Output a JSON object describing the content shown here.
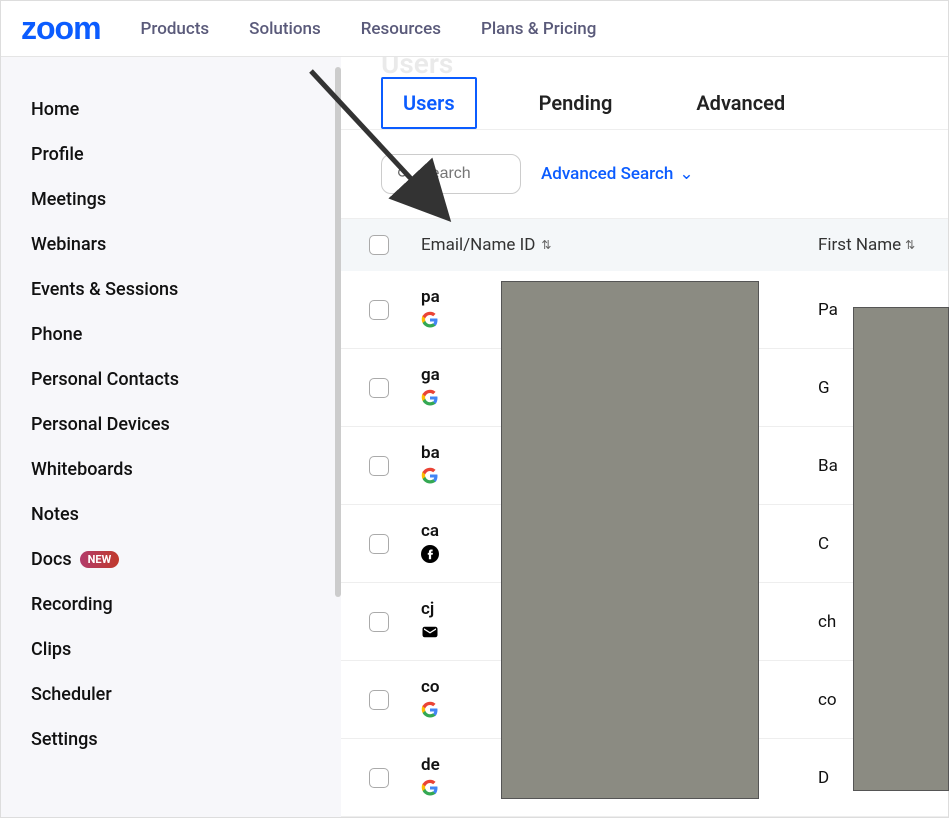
{
  "topnav": {
    "logo": "zoom",
    "items": [
      "Products",
      "Solutions",
      "Resources",
      "Plans & Pricing"
    ]
  },
  "sidebar": {
    "items": [
      {
        "label": "Home"
      },
      {
        "label": "Profile"
      },
      {
        "label": "Meetings"
      },
      {
        "label": "Webinars"
      },
      {
        "label": "Events & Sessions"
      },
      {
        "label": "Phone"
      },
      {
        "label": "Personal Contacts"
      },
      {
        "label": "Personal Devices"
      },
      {
        "label": "Whiteboards"
      },
      {
        "label": "Notes"
      },
      {
        "label": "Docs",
        "badge": "NEW"
      },
      {
        "label": "Recording"
      },
      {
        "label": "Clips"
      },
      {
        "label": "Scheduler"
      },
      {
        "label": "Settings"
      }
    ]
  },
  "main": {
    "faded_heading": "Users",
    "tabs": [
      {
        "label": "Users",
        "active": true
      },
      {
        "label": "Pending"
      },
      {
        "label": "Advanced"
      }
    ],
    "search_placeholder": "Search",
    "advanced_search": "Advanced Search",
    "columns": {
      "email": "Email/Name ID",
      "first_name": "First Name"
    },
    "rows": [
      {
        "email_prefix": "pa",
        "provider": "google",
        "fname_prefix": "Pa"
      },
      {
        "email_prefix": "ga",
        "provider": "google",
        "fname_prefix": "G"
      },
      {
        "email_prefix": "ba",
        "provider": "google",
        "fname_prefix": "Ba"
      },
      {
        "email_prefix": "ca",
        "provider": "facebook",
        "fname_prefix": "C"
      },
      {
        "email_prefix": "cj",
        "provider": "email",
        "fname_prefix": "ch"
      },
      {
        "email_prefix": "co",
        "provider": "google",
        "fname_prefix": "co"
      },
      {
        "email_prefix": "de",
        "provider": "google",
        "fname_prefix": "D"
      }
    ]
  }
}
